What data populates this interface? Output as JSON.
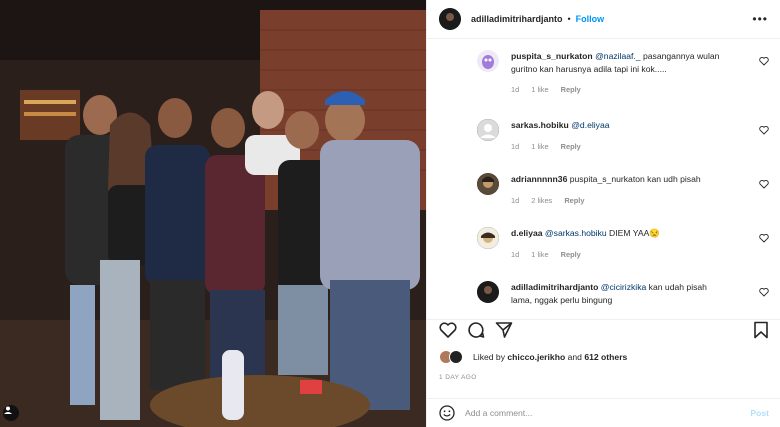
{
  "post": {
    "author": "adilladimitrihardjanto",
    "separator": "•",
    "follow_label": "Follow",
    "more_label": "•••"
  },
  "comments": [
    {
      "author": "puspita_s_nurkaton",
      "mention": "@nazilaaf._",
      "text": " pasangannya wulan guritno kan harusnya adila tapi ini kok.....",
      "time": "1d",
      "likes": "1 like",
      "reply": "Reply"
    },
    {
      "author": "sarkas.hobiku",
      "mention": "@d.eliyaa",
      "text": "",
      "time": "1d",
      "likes": "1 like",
      "reply": "Reply"
    },
    {
      "author": "adriannnnn36",
      "mention": "",
      "text": "puspita_s_nurkaton kan udh pisah",
      "time": "1d",
      "likes": "2 likes",
      "reply": "Reply"
    },
    {
      "author": "d.eliyaa",
      "mention": "@sarkas.hobiku",
      "text": " DIEM YAA😒",
      "time": "1d",
      "likes": "1 like",
      "reply": "Reply"
    },
    {
      "author": "adilladimitrihardjanto",
      "mention": "@cicirizkika",
      "text": " kan udah pisah lama, nggak perlu bingung",
      "time": "",
      "likes": "",
      "reply": ""
    }
  ],
  "likes": {
    "prefix": "Liked by",
    "user": "chicco.jerikho",
    "joiner": "and",
    "others": "612 others"
  },
  "timestamp": "1 DAY AGO",
  "add_comment": {
    "placeholder": "Add a comment...",
    "post_label": "Post"
  },
  "colors": {
    "accent": "#0095f6",
    "post_disabled": "#b2dffc",
    "meta": "#8e8e8e",
    "mention": "#00376b"
  },
  "icons": [
    "heart-icon",
    "comment-icon",
    "share-icon",
    "bookmark-icon",
    "emoji-icon",
    "more-icon",
    "user-tag-icon"
  ]
}
